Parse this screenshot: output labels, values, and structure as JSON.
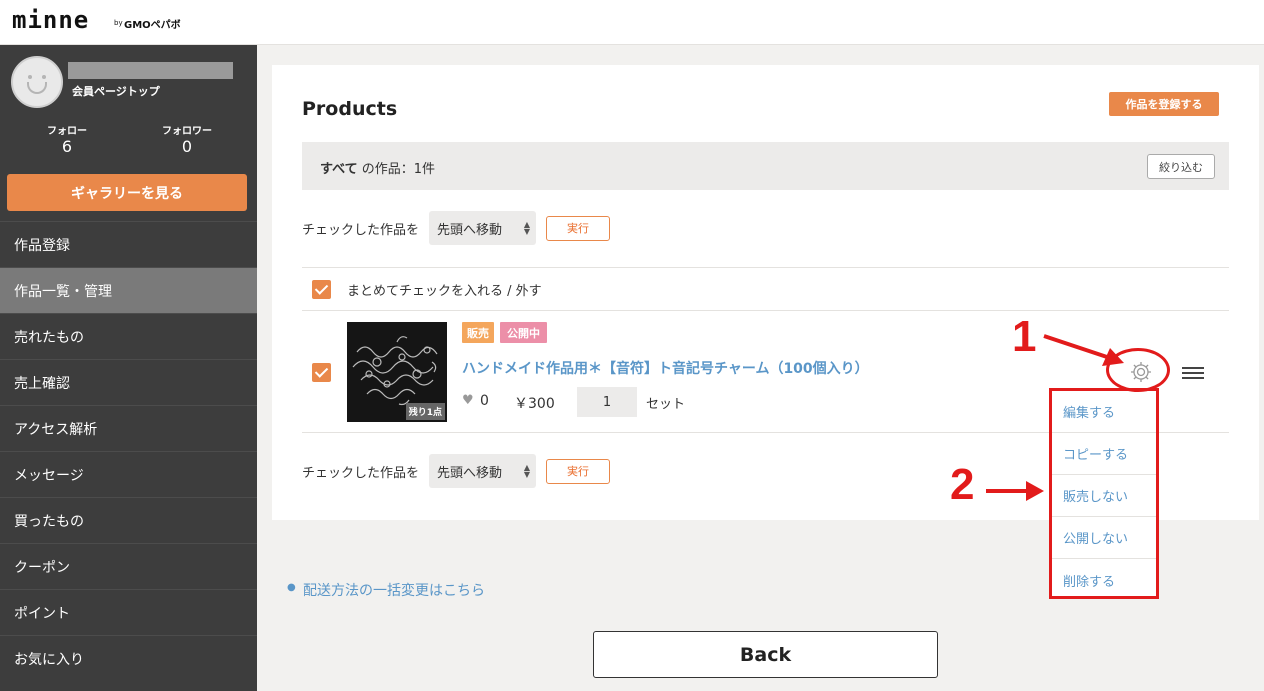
{
  "header": {
    "logo": "minne",
    "by": "by",
    "partner": "GMOペパボ"
  },
  "sidebar": {
    "member_top": "会員ページトップ",
    "follow_label": "フォロー",
    "follow_count": "6",
    "follower_label": "フォロワー",
    "follower_count": "0",
    "gallery_button": "ギャラリーを見る",
    "items": [
      {
        "label": "作品登録"
      },
      {
        "label": "作品一覧・管理",
        "active": true
      },
      {
        "label": "売れたもの"
      },
      {
        "label": "売上確認"
      },
      {
        "label": "アクセス解析"
      },
      {
        "label": "メッセージ"
      },
      {
        "label": "買ったもの"
      },
      {
        "label": "クーポン"
      },
      {
        "label": "ポイント"
      },
      {
        "label": "お気に入り"
      }
    ]
  },
  "main": {
    "title": "Products",
    "register_button": "作品を登録する",
    "filter": {
      "scope": "すべて",
      "count_text": "の作品：1件",
      "button": "絞り込む"
    },
    "bulk_action": {
      "label": "チェックした作品を",
      "selected": "先頭へ移動",
      "run_button": "実行"
    },
    "check_all_label": "まとめてチェックを入れる / 外す",
    "product": {
      "tag_sale": "販売",
      "tag_public": "公開中",
      "name": "ハンドメイド作品用＊【音符】ト音記号チャーム（100個入り）",
      "likes": "0",
      "price": "￥300",
      "quantity": "1",
      "unit": "セット",
      "stock_badge": "残り1点"
    },
    "product_menu": [
      "編集する",
      "コピーする",
      "販売しない",
      "公開しない",
      "削除する"
    ]
  },
  "annotations": {
    "step1": "1",
    "step2": "2",
    "color": "#e21b1b"
  },
  "footer": {
    "shipping_link": "配送方法の一括変更はこちら",
    "back_button": "Back"
  },
  "colors": {
    "accent": "#e9884a",
    "link": "#5a96c8",
    "sidebar": "#3d3d3d"
  }
}
